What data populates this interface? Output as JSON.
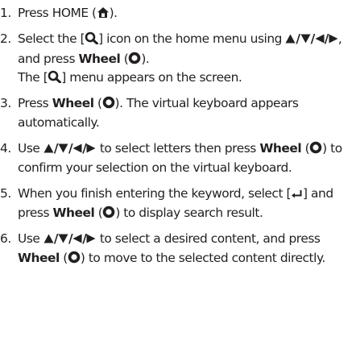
{
  "steps": [
    {
      "num": "1.",
      "parts": [
        "Press HOME (",
        ")."
      ]
    },
    {
      "num": "2.",
      "parts": [
        "Select the [",
        "] icon on the home menu using ",
        "/",
        "/",
        "/",
        ", and press ",
        "Wheel",
        " (",
        ")."
      ],
      "sub": [
        "The [",
        "] menu appears on the screen."
      ]
    },
    {
      "num": "3.",
      "parts": [
        "Press ",
        "Wheel",
        " (",
        "). The virtual keyboard appears automatically."
      ]
    },
    {
      "num": "4.",
      "parts": [
        "Use ",
        "/",
        "/",
        "/",
        " to select letters then press ",
        "Wheel",
        " (",
        ") to confirm your selection on the virtual keyboard."
      ]
    },
    {
      "num": "5.",
      "parts": [
        "When you finish entering the keyword, select [",
        "] and press ",
        "Wheel",
        " (",
        ") to display search result."
      ]
    },
    {
      "num": "6.",
      "parts": [
        "Use ",
        "/",
        "/",
        "/",
        " to select a desired content, and press ",
        "Wheel",
        " (",
        ") to move to the selected content directly."
      ]
    }
  ],
  "icons": {
    "home": "home-icon",
    "search": "search-icon",
    "wheel": "wheel-icon",
    "enter": "enter-icon",
    "up": "up-arrow-icon",
    "down": "down-arrow-icon",
    "left": "left-arrow-icon",
    "right": "right-arrow-icon"
  }
}
